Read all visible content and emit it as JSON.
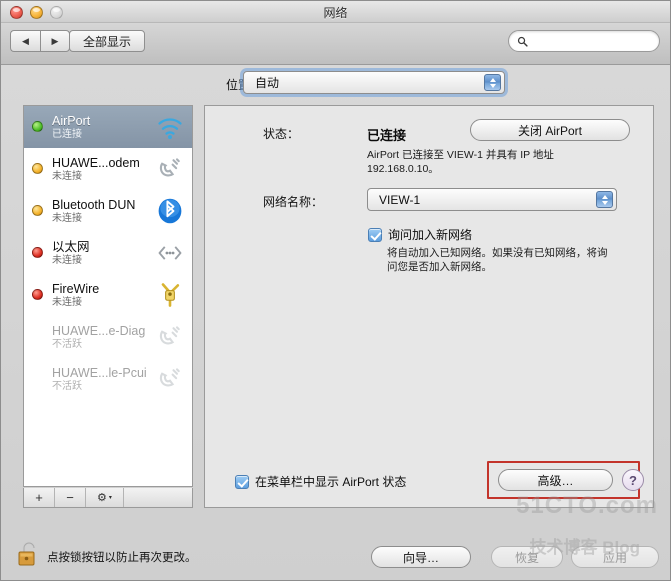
{
  "window": {
    "title": "网络",
    "traffic": {
      "close": "close-button",
      "minimize": "minimize-button",
      "zoom": "zoom-button"
    }
  },
  "toolbar": {
    "back_glyph": "◀",
    "forward_glyph": "▶",
    "show_all_label": "全部显示",
    "search_value": "",
    "search_placeholder": ""
  },
  "location": {
    "label": "位置：",
    "value": "自动"
  },
  "sidebar": {
    "services": [
      {
        "name": "AirPort",
        "state": "已连接",
        "dot": "green",
        "icon": "wifi-icon",
        "selected": true,
        "inactive": false
      },
      {
        "name": "HUAWE...odem",
        "state": "未连接",
        "dot": "orange",
        "icon": "modem-icon",
        "selected": false,
        "inactive": false
      },
      {
        "name": "Bluetooth DUN",
        "state": "未连接",
        "dot": "orange",
        "icon": "bluetooth-icon",
        "selected": false,
        "inactive": false
      },
      {
        "name": "以太网",
        "state": "未连接",
        "dot": "red",
        "icon": "ethernet-icon",
        "selected": false,
        "inactive": false
      },
      {
        "name": "FireWire",
        "state": "未连接",
        "dot": "red",
        "icon": "firewire-icon",
        "selected": false,
        "inactive": false
      },
      {
        "name": "HUAWE...e-Diag",
        "state": "不活跃",
        "dot": "none",
        "icon": "modem-icon",
        "selected": false,
        "inactive": true
      },
      {
        "name": "HUAWE...le-Pcui",
        "state": "不活跃",
        "dot": "none",
        "icon": "modem-icon",
        "selected": false,
        "inactive": true
      }
    ],
    "toolbar": {
      "add_label": "+",
      "remove_label": "−",
      "action_label": "⚙"
    }
  },
  "content": {
    "status_label": "状态：",
    "status_value": "已连接",
    "status_description": "AirPort 已连接至 VIEW-1 并具有 IP 地址 192.168.0.10。",
    "airport_toggle_label": "关闭 AirPort",
    "network_label": "网络名称：",
    "network_value": "VIEW-1",
    "ask_join_label": "询问加入新网络",
    "ask_join_checked": true,
    "ask_join_description": "将自动加入已知网络。如果没有已知网络，将询问您是否加入新网络。",
    "menubar_label": "在菜单栏中显示 AirPort 状态",
    "menubar_checked": true,
    "advanced_label": "高级…",
    "help_label": "?"
  },
  "footer": {
    "lock_text": "点按锁按钮以防止再次更改。",
    "assist_label": "向导…",
    "revert_label": "恢复",
    "apply_label": "应用",
    "revert_disabled": true,
    "apply_disabled": true
  },
  "watermark": {
    "main": "51CTO.com",
    "sub": "技术博客 Blog"
  },
  "colors": {
    "accent_blue": "#5d9ede",
    "highlight_red": "#c3342b",
    "selected_row": "#8494a6",
    "status_green": "#4fbf2a",
    "status_orange": "#f4b32c",
    "status_red": "#dd2e22"
  }
}
